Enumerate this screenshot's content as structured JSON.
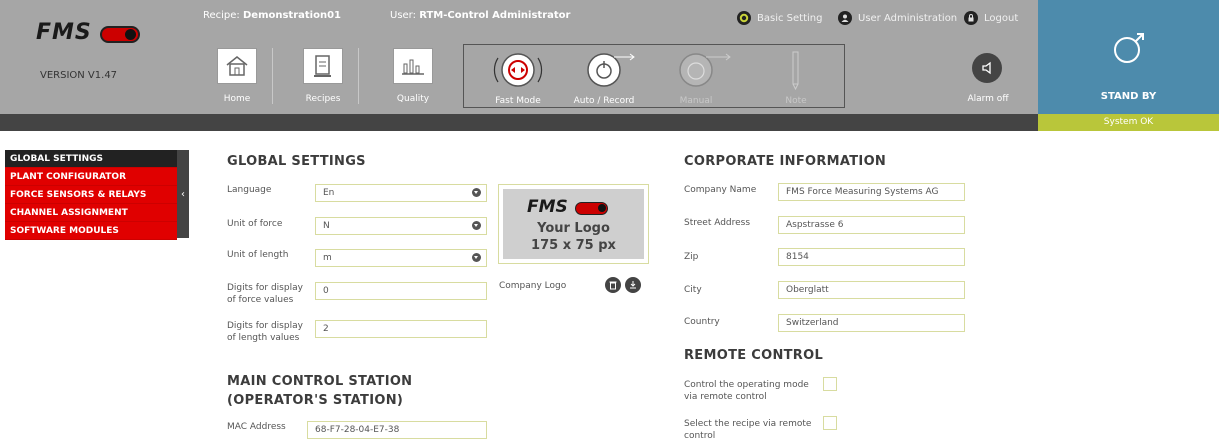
{
  "header": {
    "brand": "FMS",
    "version": "VERSION V1.47",
    "recipe_label": "Recipe:",
    "recipe_value": "Demonstration01",
    "user_label": "User:",
    "user_value": "RTM-Control Administrator",
    "links": {
      "basic_setting": "Basic Setting",
      "user_admin": "User Administration",
      "logout": "Logout"
    },
    "nav": {
      "home": "Home",
      "recipes": "Recipes",
      "quality": "Quality"
    },
    "modes": {
      "fast": "Fast Mode",
      "auto": "Auto / Record",
      "manual": "Manual",
      "note": "Note"
    },
    "alarm": "Alarm off",
    "state": "STAND BY",
    "status": "System OK",
    "colors": {
      "header_bg": "#a6a6a6",
      "standby_bg": "#4d8bac",
      "status_ok": "#b9c63a",
      "accent_red": "#e00000"
    }
  },
  "sidebar": {
    "items": [
      {
        "label": "GLOBAL SETTINGS",
        "active": true
      },
      {
        "label": "PLANT CONFIGURATOR"
      },
      {
        "label": "FORCE SENSORS & RELAYS"
      },
      {
        "label": "CHANNEL ASSIGNMENT"
      },
      {
        "label": "SOFTWARE MODULES"
      }
    ],
    "toggle": "‹"
  },
  "global": {
    "title": "GLOBAL SETTINGS",
    "language_label": "Language",
    "language_value": "En",
    "force_label": "Unit of force",
    "force_value": "N",
    "length_label": "Unit of length",
    "length_value": "m",
    "digits_force_label_1": "Digits for display",
    "digits_force_label_2": "of force values",
    "digits_force_value": "0",
    "digits_length_label_1": "Digits for display",
    "digits_length_label_2": "of length values",
    "digits_length_value": "2",
    "logo_brand": "FMS",
    "logo_your": "Your Logo",
    "logo_size": "175 x 75 px",
    "company_logo_label": "Company Logo"
  },
  "main_station": {
    "title_1": "MAIN CONTROL STATION",
    "title_2": "(OPERATOR'S STATION)",
    "mac_label": "MAC Address",
    "mac_value": "68-F7-28-04-E7-38"
  },
  "corporate": {
    "title": "CORPORATE INFORMATION",
    "company_label": "Company Name",
    "company_value": "FMS Force Measuring Systems AG",
    "street_label": "Street Address",
    "street_value": "Aspstrasse 6",
    "zip_label": "Zip",
    "zip_value": "8154",
    "city_label": "City",
    "city_value": "Oberglatt",
    "country_label": "Country",
    "country_value": "Switzerland"
  },
  "remote": {
    "title": "REMOTE CONTROL",
    "mode_label_1": "Control the operating mode",
    "mode_label_2": "via remote control",
    "recipe_label_1": "Select the recipe via remote",
    "recipe_label_2": "control"
  }
}
